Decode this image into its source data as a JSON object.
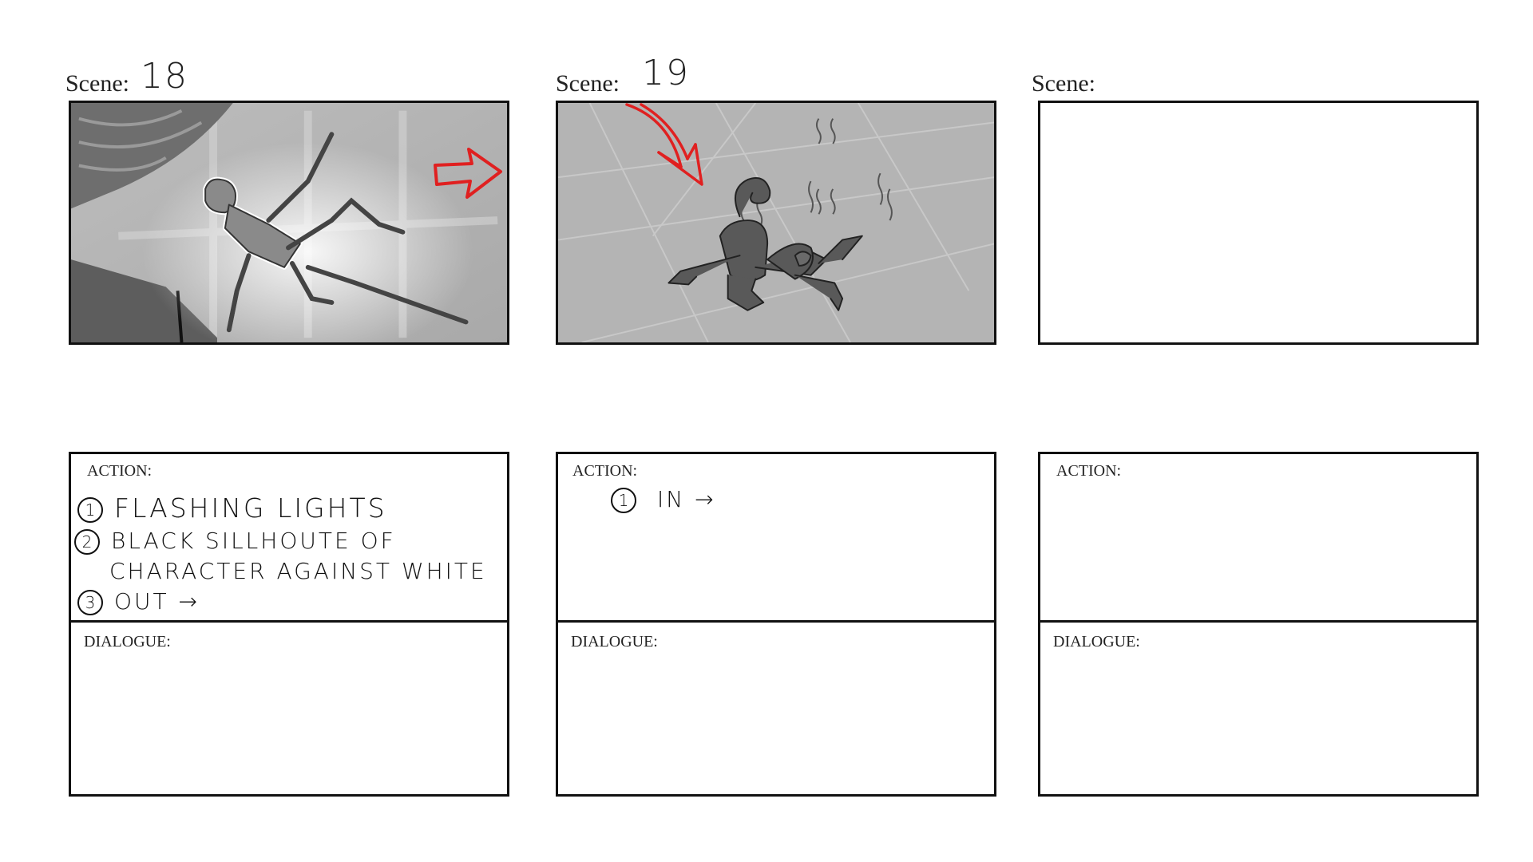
{
  "panels": [
    {
      "scene_label": "Scene:",
      "scene_number": "18",
      "action_label": "ACTION:",
      "dialogue_label": "DIALOGUE:",
      "action_notes": [
        {
          "marker": "1",
          "text": "FLASHING LIGHTS"
        },
        {
          "marker": "2",
          "text": "BLACK SILLHOUTE OF"
        },
        {
          "marker": "",
          "text": "CHARACTER AGAINST WHITE"
        },
        {
          "marker": "3",
          "text": "OUT →"
        }
      ]
    },
    {
      "scene_label": "Scene:",
      "scene_number": "19",
      "action_label": "ACTION:",
      "dialogue_label": "DIALOGUE:",
      "action_notes": [
        {
          "marker": "1",
          "text": "IN →"
        }
      ]
    },
    {
      "scene_label": "Scene:",
      "scene_number": "",
      "action_label": "ACTION:",
      "dialogue_label": "DIALOGUE:",
      "action_notes": []
    }
  ],
  "colors": {
    "border": "#111111",
    "sketch_gray": "#aaaaaa",
    "arrow_red": "#e02020"
  },
  "icons": [
    "red-arrow-right-icon",
    "red-arrow-down-icon"
  ]
}
